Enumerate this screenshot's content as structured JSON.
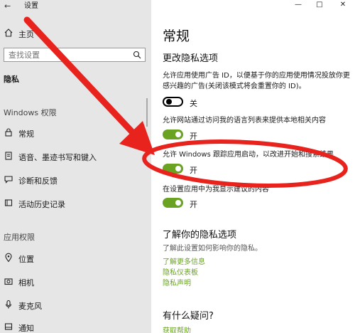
{
  "window": {
    "title": "设置",
    "controls": {
      "minimize": "—",
      "maximize": "□",
      "close": "✕"
    }
  },
  "sidebar": {
    "home_label": "主页",
    "search_placeholder": "查找设置",
    "section_title": "隐私",
    "group_windows": "Windows 权限",
    "windows_items": [
      {
        "label": "常规",
        "icon": "lock-icon"
      },
      {
        "label": "语音、墨迹书写和键入",
        "icon": "notepad-icon"
      },
      {
        "label": "诊断和反馈",
        "icon": "feedback-icon"
      },
      {
        "label": "活动历史记录",
        "icon": "history-icon"
      }
    ],
    "group_apps": "应用权限",
    "app_items": [
      {
        "label": "位置",
        "icon": "location-icon"
      },
      {
        "label": "相机",
        "icon": "camera-icon"
      },
      {
        "label": "麦克风",
        "icon": "microphone-icon"
      },
      {
        "label": "通知",
        "icon": "notification-icon"
      }
    ]
  },
  "content": {
    "page_title": "常规",
    "options_title": "更改隐私选项",
    "settings": [
      {
        "text": "允许应用使用广告 ID，以便基于你的应用使用情况投放你更感兴趣的广告(关闭该模式将会重置你的 ID)。",
        "state": "关",
        "on": false
      },
      {
        "text": "允许网站通过访问我的语言列表来提供本地相关内容",
        "state": "开",
        "on": true
      },
      {
        "text": "允许 Windows 跟踪应用启动，以改进开始和搜索结果",
        "state": "开",
        "on": true
      },
      {
        "text": "在设置应用中为我显示建议的内容",
        "state": "开",
        "on": true
      }
    ],
    "learn_title": "了解你的隐私选项",
    "learn_desc": "了解此设置如何影响你的隐私。",
    "links": [
      "了解更多信息",
      "隐私仪表板",
      "隐私声明"
    ],
    "question_title": "有什么疑问?",
    "help_link": "获取帮助"
  },
  "annotation_color": "#e8231d"
}
